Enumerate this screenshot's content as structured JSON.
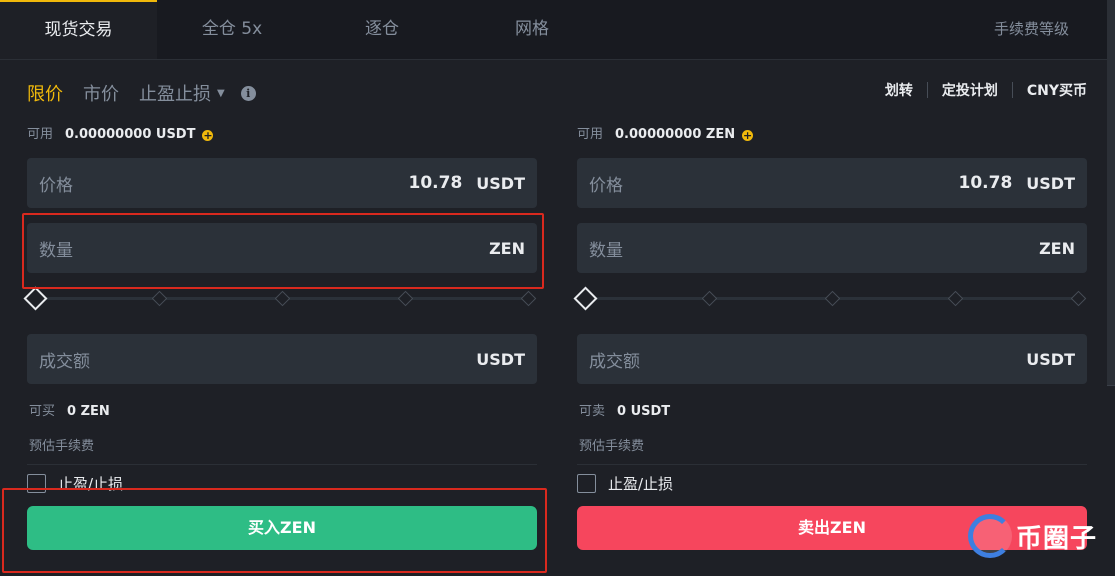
{
  "tabs": [
    {
      "label": "现货交易",
      "active": true
    },
    {
      "label": "全仓 5x",
      "active": false
    },
    {
      "label": "逐仓",
      "active": false
    },
    {
      "label": "网格",
      "active": false
    }
  ],
  "fee_level_link": "手续费等级",
  "order_types": {
    "limit": "限价",
    "market": "市价",
    "stop": "止盈止损"
  },
  "top_links": [
    "划转",
    "定投计划",
    "CNY买币"
  ],
  "buy": {
    "available_label": "可用",
    "available_value": "0.00000000 USDT",
    "price_label": "价格",
    "price_value": "10.78",
    "price_unit": "USDT",
    "amount_label": "数量",
    "amount_unit": "ZEN",
    "total_label": "成交额",
    "total_unit": "USDT",
    "max_label": "可买",
    "max_value": "0 ZEN",
    "fee_label": "预估手续费",
    "tpsl_label": "止盈/止损",
    "button": "买入ZEN"
  },
  "sell": {
    "available_label": "可用",
    "available_value": "0.00000000 ZEN",
    "price_label": "价格",
    "price_value": "10.78",
    "price_unit": "USDT",
    "amount_label": "数量",
    "amount_unit": "ZEN",
    "total_label": "成交额",
    "total_unit": "USDT",
    "max_label": "可卖",
    "max_value": "0 USDT",
    "fee_label": "预估手续费",
    "tpsl_label": "止盈/止损",
    "button": "卖出ZEN"
  },
  "watermark": "币圈子",
  "colors": {
    "accent": "#f0b90b",
    "buy": "#2ebd85",
    "sell": "#f6465d",
    "highlight": "#d9291e"
  }
}
